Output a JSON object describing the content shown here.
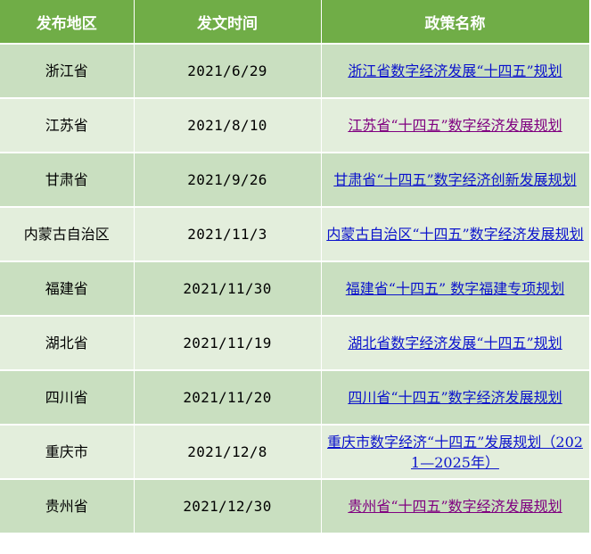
{
  "table": {
    "headers": [
      "发布地区",
      "发文时间",
      "政策名称"
    ],
    "rows": [
      {
        "region": "浙江省",
        "date": "2021/6/29",
        "policy": "浙江省数字经济发展“十四五”规划",
        "visited": false
      },
      {
        "region": "江苏省",
        "date": "2021/8/10",
        "policy": "江苏省“十四五”数字经济发展规划",
        "visited": true
      },
      {
        "region": "甘肃省",
        "date": "2021/9/26",
        "policy": "甘肃省“十四五”数字经济创新发展规划",
        "visited": false
      },
      {
        "region": "内蒙古自治区",
        "date": "2021/11/3",
        "policy": "内蒙古自治区“十四五”数字经济发展规划",
        "visited": false
      },
      {
        "region": "福建省",
        "date": "2021/11/30",
        "policy": "福建省“十四五” 数字福建专项规划",
        "visited": false
      },
      {
        "region": "湖北省",
        "date": "2021/11/19",
        "policy": "湖北省数字经济发展“十四五”规划",
        "visited": false
      },
      {
        "region": "四川省",
        "date": "2021/11/20",
        "policy": "四川省“十四五”数字经济发展规划",
        "visited": false
      },
      {
        "region": "重庆市",
        "date": "2021/12/8",
        "policy": "重庆市数字经济“十四五”发展规划（2021—2025年）",
        "visited": false
      },
      {
        "region": "贵州省",
        "date": "2021/12/30",
        "policy": "贵州省“十四五”数字经济发展规划",
        "visited": true
      }
    ]
  },
  "colors": {
    "header_bg": "#70ad47",
    "row_odd_bg": "#c9dfc0",
    "row_even_bg": "#e3eedc",
    "link": "#0b13cc",
    "visited_link": "#800080"
  }
}
